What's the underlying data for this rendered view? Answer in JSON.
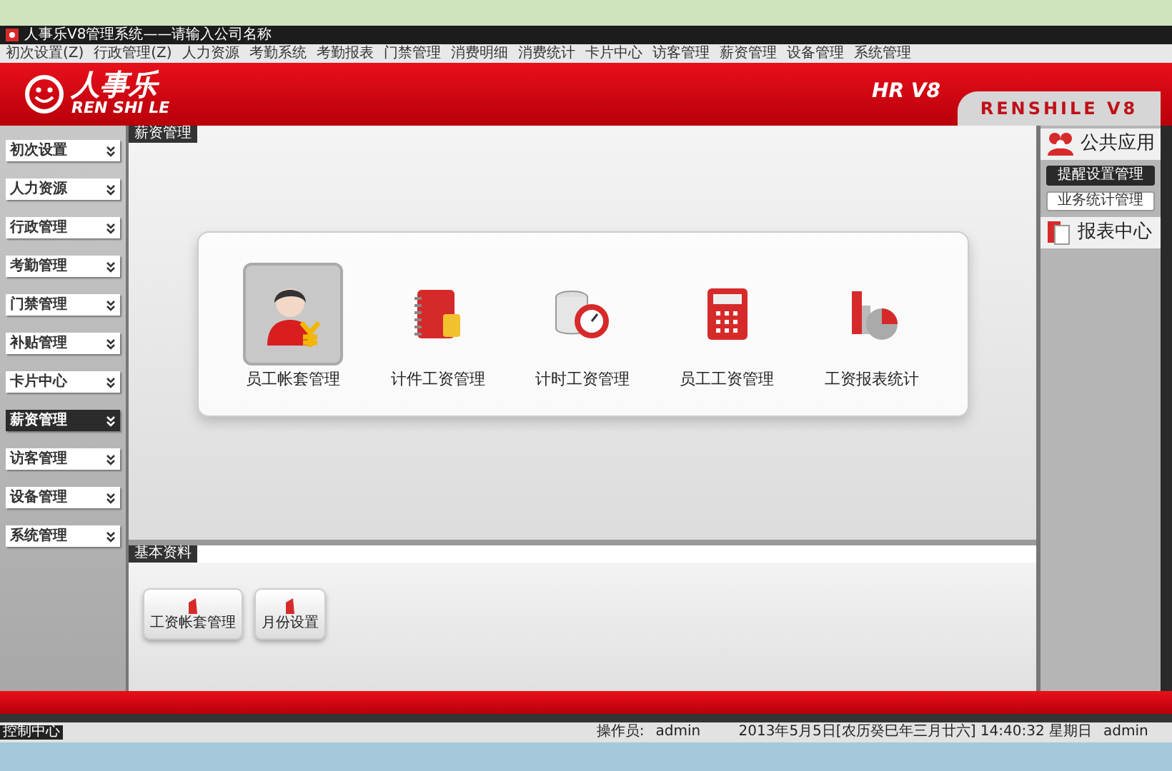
{
  "window": {
    "title": "人事乐V8管理系统——请输入公司名称"
  },
  "menu": [
    "初次设置(Z)",
    "行政管理(Z)",
    "人力资源",
    "考勤系统",
    "考勤报表",
    "门禁管理",
    "消费明细",
    "消费统计",
    "卡片中心",
    "访客管理",
    "薪资管理",
    "设备管理",
    "系统管理"
  ],
  "header": {
    "logo_text": "人事乐",
    "logo_sub": "REN SHI LE",
    "version": "HR V8",
    "brand": "RENSHILE V8"
  },
  "sidebar": {
    "items": [
      {
        "label": "初次设置",
        "selected": false
      },
      {
        "label": "人力资源",
        "selected": false
      },
      {
        "label": "行政管理",
        "selected": false
      },
      {
        "label": "考勤管理",
        "selected": false
      },
      {
        "label": "门禁管理",
        "selected": false
      },
      {
        "label": "补贴管理",
        "selected": false
      },
      {
        "label": "卡片中心",
        "selected": false
      },
      {
        "label": "薪资管理",
        "selected": true
      },
      {
        "label": "访客管理",
        "selected": false
      },
      {
        "label": "设备管理",
        "selected": false
      },
      {
        "label": "系统管理",
        "selected": false
      }
    ]
  },
  "main": {
    "section_title": "薪资管理",
    "modules": [
      {
        "label": "员工帐套管理",
        "kind": "person",
        "selected": true
      },
      {
        "label": "计件工资管理",
        "kind": "notebook",
        "selected": false
      },
      {
        "label": "计时工资管理",
        "kind": "clock",
        "selected": false
      },
      {
        "label": "员工工资管理",
        "kind": "calculator",
        "selected": false
      },
      {
        "label": "工资报表统计",
        "kind": "chart",
        "selected": false
      }
    ]
  },
  "basic": {
    "title": "基本资料",
    "buttons": [
      "工资帐套管理",
      "月份设置"
    ]
  },
  "right_panel": {
    "sections": [
      {
        "title": "公共应用",
        "kind": "people",
        "items": [
          {
            "label": "提醒设置管理",
            "selected": true
          },
          {
            "label": "业务统计管理",
            "selected": false
          }
        ]
      },
      {
        "title": "报表中心",
        "kind": "report"
      }
    ]
  },
  "status_bar": {
    "left": "控制中心",
    "operator_label": "操作员:",
    "operator": "admin",
    "datetime": "2013年5月5日[农历癸巳年三月廿六] 14:40:32 星期日",
    "user": "admin"
  }
}
